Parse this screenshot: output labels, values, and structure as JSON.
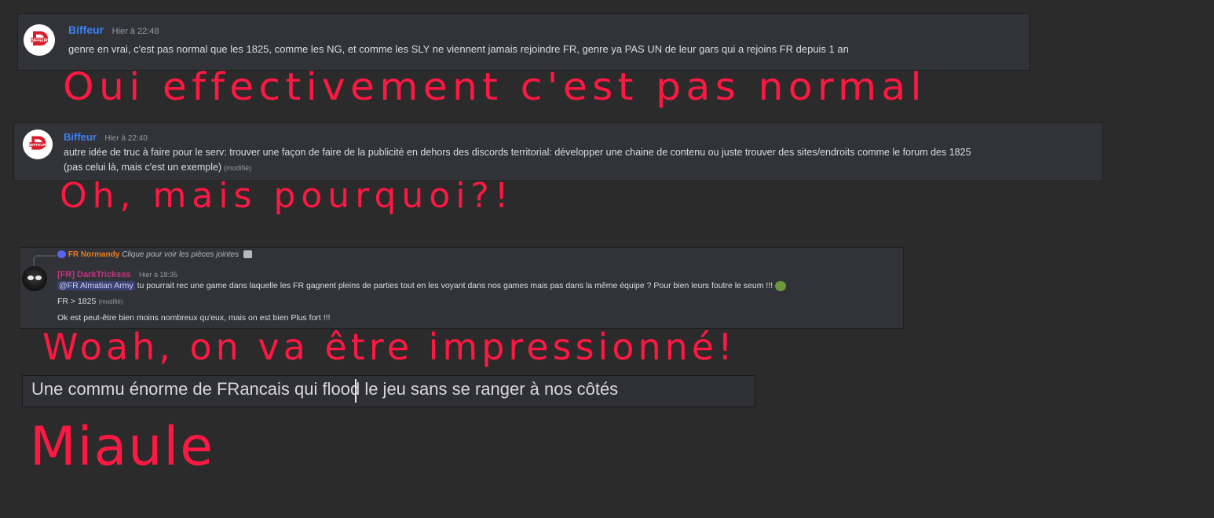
{
  "messages": [
    {
      "author": "Biffeur",
      "time": "Hier à 22:48",
      "content": "genre en vrai, c'est pas normal que les 1825, comme les NG, et comme les SLY ne viennent jamais rejoindre FR, genre ya PAS UN de leur gars qui a rejoins FR depuis 1 an",
      "avatar_text": "BIFFEUR"
    },
    {
      "author": "Biffeur",
      "time": "Hier à 22:40",
      "content_line1": "autre idée de truc à faire pour le serv: trouver une façon de faire de la publicité en dehors des discords territorial: développer une chaine de contenu ou juste trouver des sites/endroits comme le forum des 1825",
      "content_line2": "(pas celui là, mais c'est un exemple)",
      "edited": "(modifié)",
      "avatar_text": "BIFFEUR"
    },
    {
      "reply_tag": "FR",
      "reply_author": "Normandy",
      "reply_text": "Clique pour voir les pièces jointes",
      "author": "[FR] DarkTricksss",
      "time": "Hier à 18:35",
      "mention": "@FR Almatian Army",
      "content_line1": " tu pourrait rec une game dans laquelle les FR gagnent pleins de parties tout en les voyant dans nos games mais pas dans la même équipe ? Pour bien leurs foutre le seum !!!",
      "content_line2": "FR > 1825",
      "edited": "(modifié)",
      "content_line3": "Ok est peut-être bien moins nombreux qu'eux, mais on est bien Plus fort !!!"
    }
  ],
  "annotations": [
    "Oui effectivement c'est pas normal",
    "Oh, mais pourquoi?!",
    "Woah, on va être impressionné!",
    "Miaule"
  ],
  "quote": "Une commu énorme de FRancais qui flood le jeu sans se ranger à nos côtés",
  "colors": {
    "background": "#2b2b2b",
    "message_bg": "#313338",
    "author_blue": "#3b82f6",
    "author_pink": "#c13584",
    "annotation_red": "#ff1842",
    "reply_orange": "#e67e22"
  }
}
